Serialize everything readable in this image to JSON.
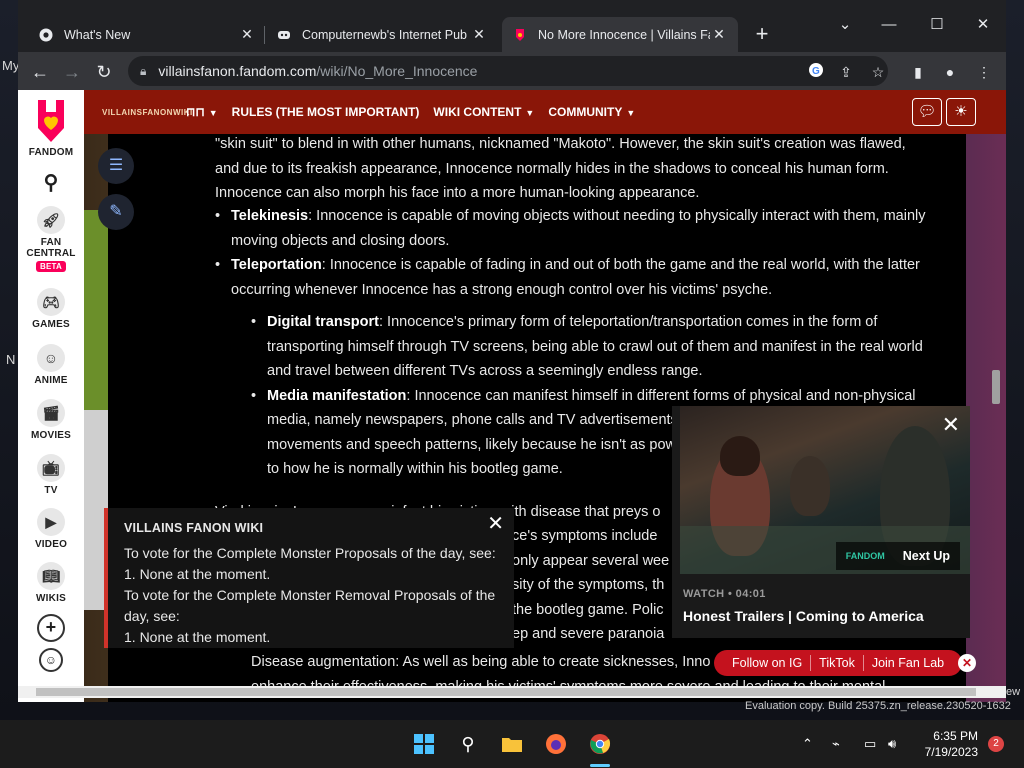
{
  "browser": {
    "tabs": [
      {
        "title": "What's New",
        "icon": "chrome-icon"
      },
      {
        "title": "Computernewb's Internet Pub H",
        "icon": "discord-icon"
      },
      {
        "title": "No More Innocence | Villains Fan",
        "icon": "fandom-icon",
        "active": true
      }
    ],
    "url_host": "villainsfanon.fandom.com",
    "url_path": "/wiki/No_More_Innocence"
  },
  "rail": {
    "brand": "FANDOM",
    "items": [
      "FAN CENTRAL",
      "GAMES",
      "ANIME",
      "MOVIES",
      "TV",
      "VIDEO",
      "WIKIS"
    ],
    "beta": "BETA"
  },
  "wikibar": {
    "logo": "VILLAINSFANONWIKI",
    "nav": [
      "RULES (THE MOST IMPORTANT)",
      "WIKI CONTENT",
      "COMMUNITY"
    ]
  },
  "article": {
    "intro_lines": [
      "\"skin suit\" to blend in with other humans, nicknamed \"Makoto\". However, the skin suit's creation was flawed,",
      "and due to its freakish appearance, Innocence normally hides in the shadows to conceal his human form.",
      "Innocence can also morph his face into a more human-looking appearance."
    ],
    "telekinesis_title": "Telekinesis",
    "telekinesis_text": ": Innocence is capable of moving objects without needing to physically interact with them, mainly moving objects and closing doors.",
    "teleportation_title": "Teleportation",
    "teleportation_text": ": Innocence is capable of fading in and out of both the game and the real world, with the latter occurring whenever Innocence has a strong enough control over his victims' psyche.",
    "digital_title": "Digital transport",
    "digital_text": ": Innocence's primary form of teleportation/transportation comes in the form of transporting himself through TV screens, being able to crawl out of them and manifest in the real world and travel between different TVs across a seemingly endless range.",
    "media_title": "Media manifestation",
    "media_text": ": Innocence can manifest himself in different forms of physical and non-physical media, namely newspapers, phone calls and TV advertisements, a",
    "media_line3": "movements and speech patterns, likely because he isn't as powe",
    "media_line4": "to how he is normally within his bootleg game.",
    "partial": [
      "Virokinesis: Innocence can infect his victims with disease that preys o",
      "ce's symptoms include",
      "only appear several wee",
      "sity of the symptoms, th",
      "the bootleg game. Polic",
      "ep and severe paranoia"
    ],
    "bottom_line1": "Disease augmentation: As well as being able to create sicknesses, Inno",
    "bottom_line2": "enhance their effectiveness, making his victims' symptoms more severe and leading to their mental"
  },
  "notice": {
    "title": "VILLAINS FANON WIKI",
    "lines": [
      "To vote for the Complete Monster Proposals of the day, see:",
      "1. None at the moment.",
      "To vote for the Complete Monster Removal Proposals of the day, see:",
      "1. None at the moment."
    ]
  },
  "video": {
    "next_up": "Next Up",
    "fandom_tag": "FANDOM",
    "meta": "WATCH • 04:01",
    "title": "Honest Trailers | Coming to America"
  },
  "social": [
    "Follow on IG",
    "TikTok",
    "Join Fan Lab"
  ],
  "desktop": {
    "eval": "Evaluation copy. Build 25375.zn_release.230520-1632",
    "frag_my": "My",
    "frag_n": "N",
    "frag_ew": "ew"
  },
  "taskbar": {
    "time": "6:35 PM",
    "date": "7/19/2023",
    "badge": "2"
  }
}
